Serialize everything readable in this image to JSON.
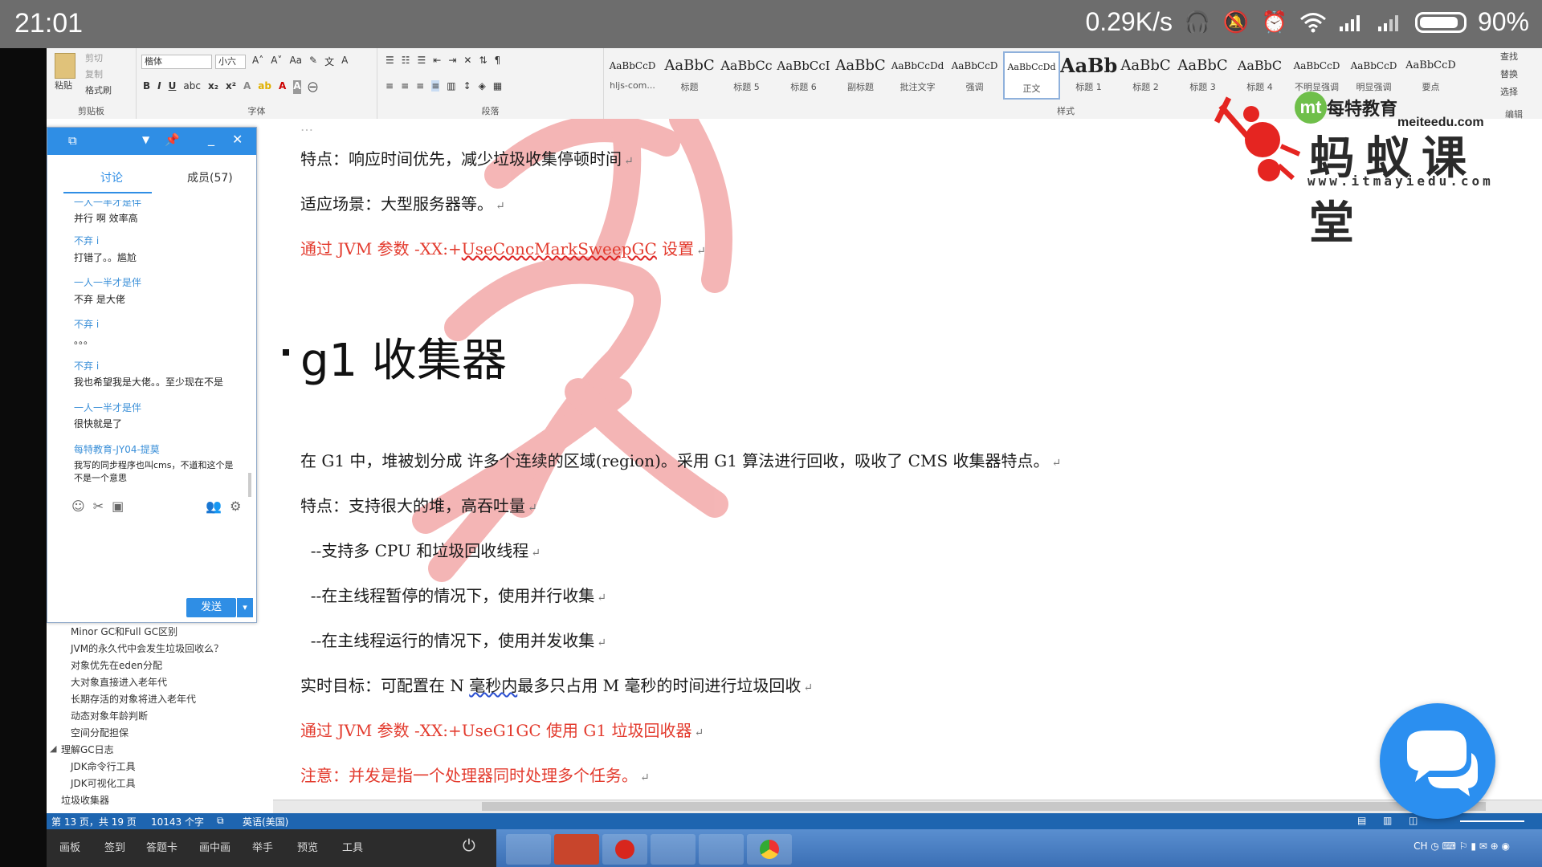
{
  "status_bar": {
    "time": "21:01",
    "network_speed": "0.29K/s",
    "battery": "90%",
    "battery_level": 0.9,
    "icons": [
      "headphones-icon",
      "mute-icon",
      "alarm-icon",
      "wifi-icon",
      "signal-icon",
      "signal-icon",
      "battery-icon"
    ]
  },
  "ribbon": {
    "clipboard": {
      "paste": "粘贴",
      "cut": "剪切",
      "copy": "复制",
      "format_painter": "格式刷",
      "label": "剪贴板"
    },
    "font": {
      "family": "楷体",
      "size": "小六",
      "label": "字体"
    },
    "paragraph": {
      "label": "段落"
    },
    "styles": {
      "label": "样式",
      "items": [
        {
          "sample": "AaBbCcD",
          "name": "hljs-com..."
        },
        {
          "sample": "AaBbC",
          "name": "标题"
        },
        {
          "sample": "AaBbCc",
          "name": "标题 5"
        },
        {
          "sample": "AaBbCcI",
          "name": "标题 6"
        },
        {
          "sample": "AaBbC",
          "name": "副标题"
        },
        {
          "sample": "AaBbCcDd",
          "name": "批注文字"
        },
        {
          "sample": "AaBbCcD",
          "name": "强调"
        },
        {
          "sample": "AaBbCcDd",
          "name": "正文"
        },
        {
          "sample": "AaBb",
          "name": "标题 1"
        },
        {
          "sample": "AaBbC",
          "name": "标题 2"
        },
        {
          "sample": "AaBbC",
          "name": "标题 3"
        },
        {
          "sample": "AaBbC",
          "name": "标题 4"
        },
        {
          "sample": "AaBbCcD",
          "name": "不明显强调"
        },
        {
          "sample": "AaBbCcD",
          "name": "明显强调"
        },
        {
          "sample": "AaBbCcD",
          "name": "要点"
        }
      ],
      "selected_index": 7
    },
    "editing": {
      "find": "查找",
      "replace": "替换",
      "select": "选择",
      "label": "编辑"
    }
  },
  "logo": {
    "brand": "每特教育",
    "brand_url": "meiteedu.com",
    "name": "蚂蚁课堂",
    "url": "www.itmayiedu.com"
  },
  "document": {
    "lines": [
      {
        "text": "特点：响应时间优先，减少垃圾收集停顿时间",
        "red": false
      },
      {
        "text": "适应场景：大型服务器等。",
        "red": false
      },
      {
        "pre": "通过 JVM 参数 -XX:+",
        "ul": "UseConcMarkSweepGC",
        "post": " 设置",
        "red": true
      },
      {
        "text": "在 G1 中，堆被划分成 许多个连续的区域(region)。采用 G1 算法进行回收，吸收了 CMS 收集器特点。",
        "red": false
      },
      {
        "text": "特点：支持很大的堆，高吞吐量",
        "red": false
      },
      {
        "text": "  --支持多 CPU 和垃圾回收线程",
        "red": false
      },
      {
        "text": "  --在主线程暂停的情况下，使用并行收集",
        "red": false
      },
      {
        "text": "  --在主线程运行的情况下，使用并发收集",
        "red": false
      },
      {
        "pre": "实时目标：可配置在 N ",
        "ul": "毫秒内",
        "post": "最多只占用 M 毫秒的时间进行垃圾回收",
        "red": false
      },
      {
        "text": "通过 JVM 参数 -XX:+UseG1GC 使用 G1 垃圾回收器",
        "red": true
      },
      {
        "text": "注意：并发是指一个处理器同时处理多个任务。",
        "red": true
      }
    ],
    "heading": "g1 收集器"
  },
  "chat": {
    "tabs": [
      "讨论",
      "成员(57)"
    ],
    "messages": [
      {
        "name": "一人一半才是伴",
        "text": "并行 啊 效率高"
      },
      {
        "name": "不弃 i",
        "text": "打错了。。尴尬"
      },
      {
        "name": "一人一半才是伴",
        "text": "不弃 是大佬"
      },
      {
        "name": "不弃 i",
        "text": "。。。"
      },
      {
        "name": "不弃 i",
        "text": "我也希望我是大佬。。至少现在不是"
      },
      {
        "name": "一人一半才是伴",
        "text": "很快就是了"
      },
      {
        "name": "每特教育-JY04-提莫",
        "text": "我写的同步程序也叫cms，不道和这个是",
        "text2": "不是一个意思"
      }
    ],
    "send": "发送"
  },
  "nav": {
    "items": [
      {
        "text": "Minor GC和Full GC区别",
        "level": 2
      },
      {
        "text": "JVM的永久代中会发生垃圾回收么？",
        "level": 2
      },
      {
        "text": "对象优先在eden分配",
        "level": 2
      },
      {
        "text": "大对象直接进入老年代",
        "level": 2
      },
      {
        "text": "长期存活的对象将进入老年代",
        "level": 2
      },
      {
        "text": "动态对象年龄判断",
        "level": 2
      },
      {
        "text": "空间分配担保",
        "level": 2
      },
      {
        "text": "理解GC日志",
        "level": 1
      },
      {
        "text": "JDK命令行工具",
        "level": 2
      },
      {
        "text": "JDK可视化工具",
        "level": 2
      },
      {
        "text": "垃圾收集器",
        "level": 1
      }
    ]
  },
  "word_status": {
    "page": "第 13 页，共 19 页",
    "words": "10143 个字",
    "lang": "英语(美国)"
  },
  "bottom_toolbar": {
    "items": [
      "画板",
      "签到",
      "答题卡",
      "画中画",
      "举手",
      "预览",
      "工具"
    ]
  },
  "colors": {
    "accent": "#2f8ee5",
    "doc_red": "#e33b2e",
    "status_bar": "#6d6d6d"
  }
}
